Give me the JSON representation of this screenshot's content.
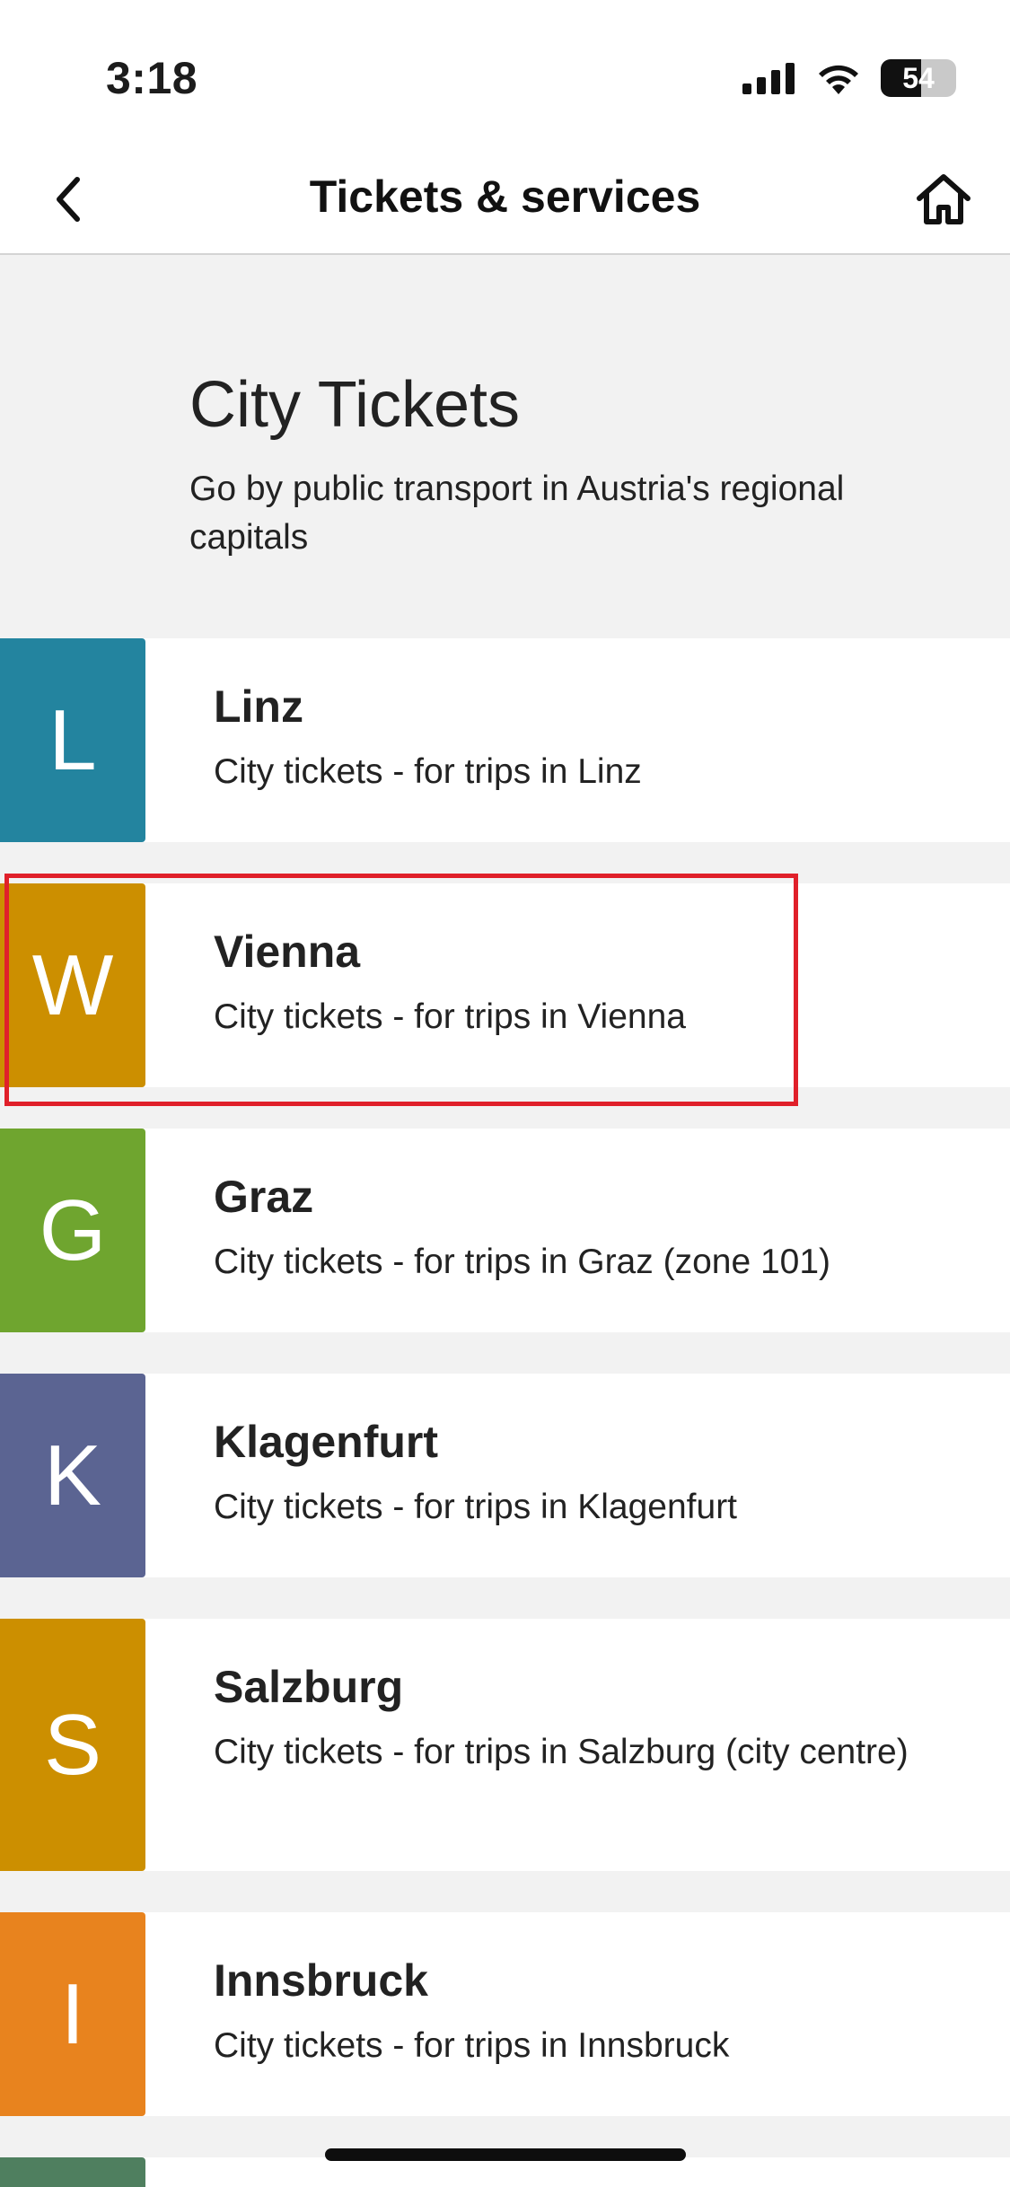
{
  "status_bar": {
    "time": "3:18",
    "battery_level": "54",
    "battery_fraction": 0.54,
    "icons": [
      "signal-icon",
      "wifi-icon",
      "battery-icon"
    ]
  },
  "nav": {
    "title": "Tickets & services",
    "back_icon": "chevron-left-icon",
    "home_icon": "home-icon"
  },
  "header": {
    "title": "City Tickets",
    "subtitle": "Go by public transport in Austria's regional capitals"
  },
  "cities": [
    {
      "letter": "L",
      "name": "Linz",
      "description": "City tickets - for trips in Linz",
      "color": "#23849f"
    },
    {
      "letter": "W",
      "name": "Vienna",
      "description": "City tickets - for trips in Vienna",
      "color": "#cc8f00"
    },
    {
      "letter": "G",
      "name": "Graz",
      "description": "City tickets - for trips in Graz (zone 101)",
      "color": "#6fa52f"
    },
    {
      "letter": "K",
      "name": "Klagenfurt",
      "description": "City tickets - for trips in Klagenfurt",
      "color": "#5b6492"
    },
    {
      "letter": "S",
      "name": "Salzburg",
      "description": "City tickets - for trips in Salzburg (city centre)",
      "color": "#cc8f00"
    },
    {
      "letter": "I",
      "name": "Innsbruck",
      "description": "City tickets - for trips in Innsbruck",
      "color": "#e8831e"
    }
  ],
  "highlighted_city": "Vienna",
  "colors": {
    "highlight_border": "#e0202a",
    "background": "#f2f2f2",
    "next_item_partial": "#4f7f5f"
  }
}
